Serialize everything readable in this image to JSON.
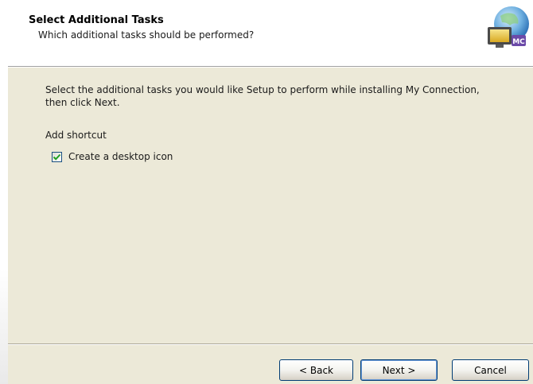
{
  "header": {
    "title": "Select Additional Tasks",
    "subtitle": "Which additional tasks should be performed?"
  },
  "body": {
    "instructions": "Select the additional tasks you would like Setup to perform while installing My Connection, then click Next.",
    "group_label": "Add shortcut",
    "tasks": [
      {
        "label": "Create a desktop icon",
        "checked": true
      }
    ]
  },
  "buttons": {
    "back": "< Back",
    "next": "Next >",
    "cancel": "Cancel"
  },
  "icons": {
    "logo": "wizard-computer-globe-icon",
    "check": "checkmark-icon"
  },
  "colors": {
    "dialog_face": "#ece9d8",
    "header_bg": "#ffffff",
    "check_green": "#21a121",
    "button_border": "#003c74"
  }
}
